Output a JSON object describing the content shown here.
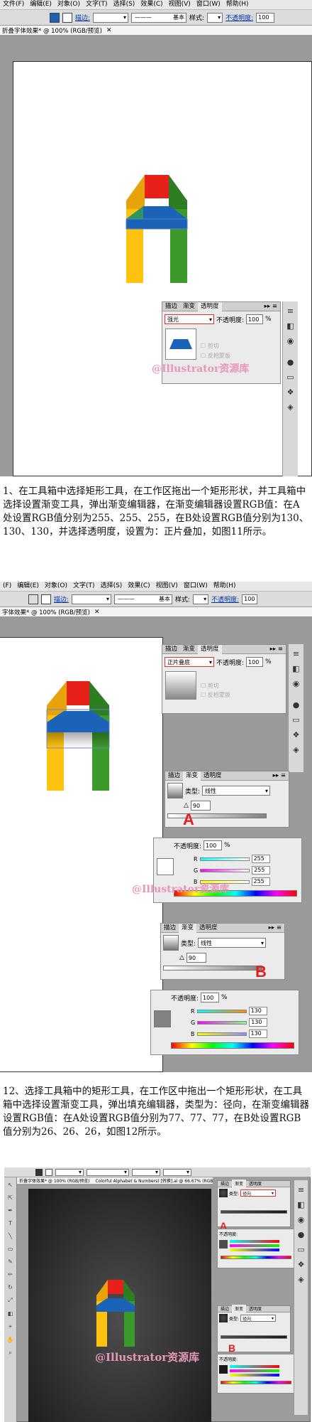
{
  "menu": [
    "文件(F)",
    "编辑(E)",
    "对象(O)",
    "文字(T)",
    "选择(S)",
    "效果(C)",
    "视图(V)",
    "窗口(W)",
    "帮助(H)"
  ],
  "menu2": [
    "(F)",
    "编辑(E)",
    "对象(O)",
    "文字(T)",
    "选择(S)",
    "效果(C)",
    "视图(V)",
    "窗口(W)",
    "帮助(H)"
  ],
  "options": {
    "stroke_label": "描边:",
    "brush_label": "基本",
    "style_label": "样式:",
    "opacity_label": "不透明度:",
    "opacity_value": "100"
  },
  "doc_tab1": "折叠字体效果* @ 100% (RGB/预览)",
  "doc_tab2": "字体效果* @ 100% (RGB/预览)",
  "doc_tab3": "折叠字体效果* @ 100% (RGB/预览)",
  "doc_tab3b": "Colorful Alphabet & Numbers) [转换].ai @ 66.67% (RGB/预览)",
  "transparency_panel": {
    "tabs": [
      "描边",
      "渐变",
      "透明度"
    ],
    "mode1": "强光",
    "mode2": "正片叠底",
    "opacity_label": "不透明度:",
    "opacity_value": "100",
    "unit": "%",
    "clip": "剪切",
    "invert": "反相蒙版"
  },
  "gradient_panel": {
    "tabs": [
      "描边",
      "渐变",
      "透明度"
    ],
    "type_label": "类型:",
    "type_linear": "线性",
    "type_radial": "径向",
    "angle": "90",
    "opacity_label": "不透明度:",
    "opacity_value": "100",
    "unit": "%",
    "channels": [
      "R",
      "G",
      "B"
    ],
    "values_a": [
      "255",
      "255",
      "255"
    ],
    "values_b": [
      "130",
      "130",
      "130"
    ]
  },
  "labels": {
    "a": "A",
    "b": "B"
  },
  "watermark": "@Illustrator资源库",
  "step11_text": "1、在工具箱中选择矩形工具，在工作区拖出一个矩形形状，并工具箱中选择设置渐变工具，弹出渐变编辑器，在渐变编辑器设置RGB值：在A处设置RGB值分别为255、255、255，在B处设置RGB值分别为130、130、130，并选择透明度，设置为：正片叠加，如图11所示。",
  "step12_text": "12、选择工具箱中的矩形工具，在工作区中拖出一个矩形形状，在工具箱中选择设置渐变工具，弹出填充编辑器，类型为：径向，在渐变编辑器设置RGB值：在A处设置RGB值分别为77、77、77，在B处设置RGB值分别为26、26、26，如图12所示。",
  "colors": {
    "red": "#e8201a",
    "yellow": "#ffc20e",
    "green": "#3c9a2a",
    "blue": "#1a63b8",
    "highlight": "#e03030",
    "watermark": "#e896b8"
  },
  "icons": [
    "fill-swatch-icon",
    "stroke-swatch-icon",
    "panel-menu-icon",
    "tool-icon",
    "letter-a-artwork"
  ]
}
